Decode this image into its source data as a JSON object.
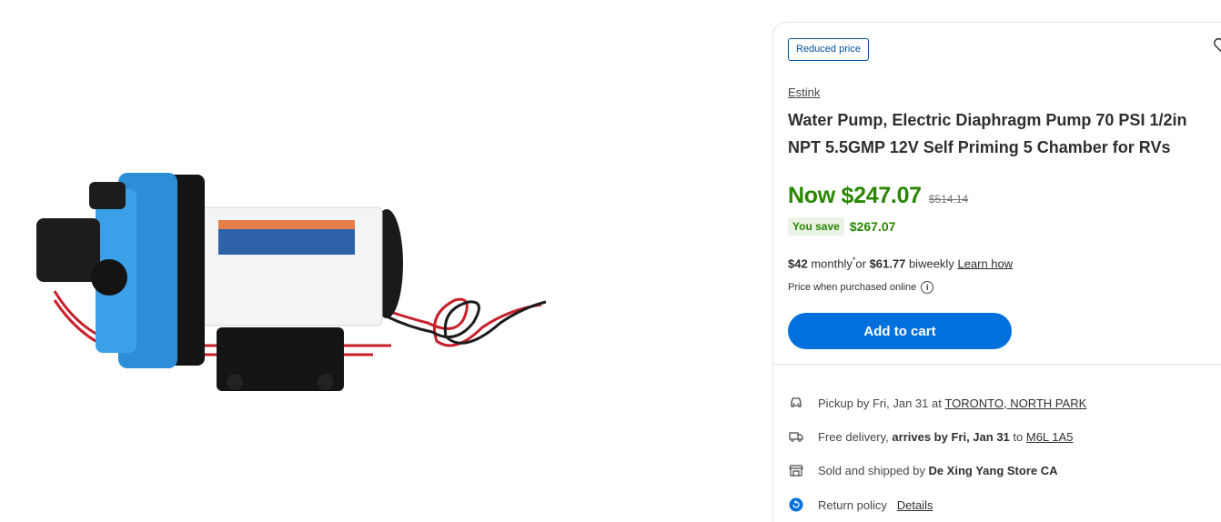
{
  "product_image": {
    "alt": "Electric diaphragm water pump",
    "icon": "product-photo"
  },
  "buybox": {
    "badge": "Reduced price",
    "favorite_icon": "heart-icon",
    "brand": "Estink",
    "title": "Water Pump, Electric Diaphragm Pump 70 PSI 1/2in NPT 5.5GMP 12V Self Priming 5 Chamber for RVs",
    "price_now": "Now $247.07",
    "price_was": "$514.14",
    "you_save_label": "You save",
    "you_save_amount": "$267.07",
    "monthly_amount": "$42",
    "monthly_label": "monthly",
    "monthly_asterisk": "*",
    "or_label": "or",
    "biweekly_amount": "$61.77",
    "biweekly_label": "biweekly",
    "learn_how": "Learn how",
    "price_online": "Price when purchased online",
    "add_to_cart": "Add to cart"
  },
  "fulfillment": {
    "pickup_label": "Pickup by Fri, Jan 31 at",
    "pickup_store": "TORONTO, NORTH PARK",
    "delivery_label": "Free delivery,",
    "delivery_arrives": "arrives by Fri, Jan 31",
    "delivery_to": "to",
    "delivery_postal": "M6L 1A5",
    "sold_label": "Sold and shipped by",
    "sold_seller": "De Xing Yang Store CA",
    "return_label": "Return policy",
    "return_details": "Details"
  },
  "colors": {
    "accent_blue": "#0071dc",
    "price_green": "#2a8703",
    "badge_blue": "#004f9a"
  }
}
